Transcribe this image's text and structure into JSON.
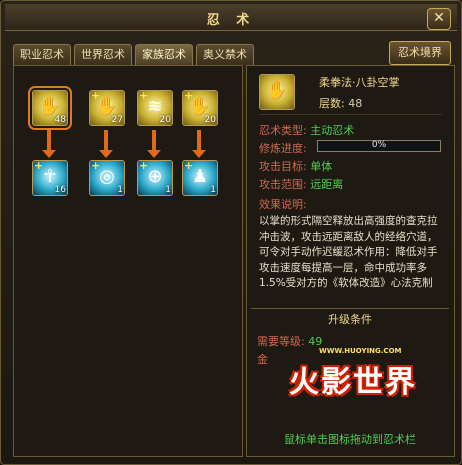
{
  "window": {
    "title": "忍 术",
    "close_label": "✕"
  },
  "tabs": [
    {
      "label": "职业忍术",
      "active": false
    },
    {
      "label": "世界忍术",
      "active": false
    },
    {
      "label": "家族忍术",
      "active": true
    },
    {
      "label": "奥义禁术",
      "active": false
    }
  ],
  "realm_button": "忍术境界",
  "skills_row1": [
    {
      "count": "48",
      "icon": "palm-icon",
      "selected": true
    },
    {
      "count": "27",
      "icon": "palm-strike-icon",
      "selected": false
    },
    {
      "count": "20",
      "icon": "claw-strike-icon",
      "selected": false
    },
    {
      "count": "20",
      "icon": "open-hand-icon",
      "selected": false
    }
  ],
  "skills_row2": [
    {
      "count": "16",
      "icon": "body-meridian-icon"
    },
    {
      "count": "1",
      "icon": "swirl-icon"
    },
    {
      "count": "1",
      "icon": "target-icon"
    },
    {
      "count": "1",
      "icon": "figure-icon"
    }
  ],
  "plus_sign": "+",
  "detail": {
    "name": "柔拳法·八卦空掌",
    "layer_label": "层数:",
    "layer_value": "48",
    "type_label": "忍术类型:",
    "type_value": "主动忍术",
    "progress_label": "修炼进度:",
    "progress_text": "0%",
    "progress_fraction": 0,
    "target_label": "攻击目标:",
    "target_value": "单体",
    "range_label": "攻击范围:",
    "range_value": "远距离",
    "desc_label": "效果说明:",
    "description": "以掌的形式隔空释放出高强度的查克拉冲击波，攻击远距离敌人的经络穴道，可令对手动作迟缓忍术作用：降低对手攻击速度每提高一层，命中成功率多1.5%受对方的《软体改造》心法克制"
  },
  "upgrade": {
    "title": "升级条件",
    "level_label": "需要等级:",
    "level_value": "49",
    "gold_label": "金",
    "logo_url": "WWW.HUOYING.COM",
    "logo_text": "火影世界",
    "hint": "鼠标单击图标拖动到忍术栏"
  }
}
